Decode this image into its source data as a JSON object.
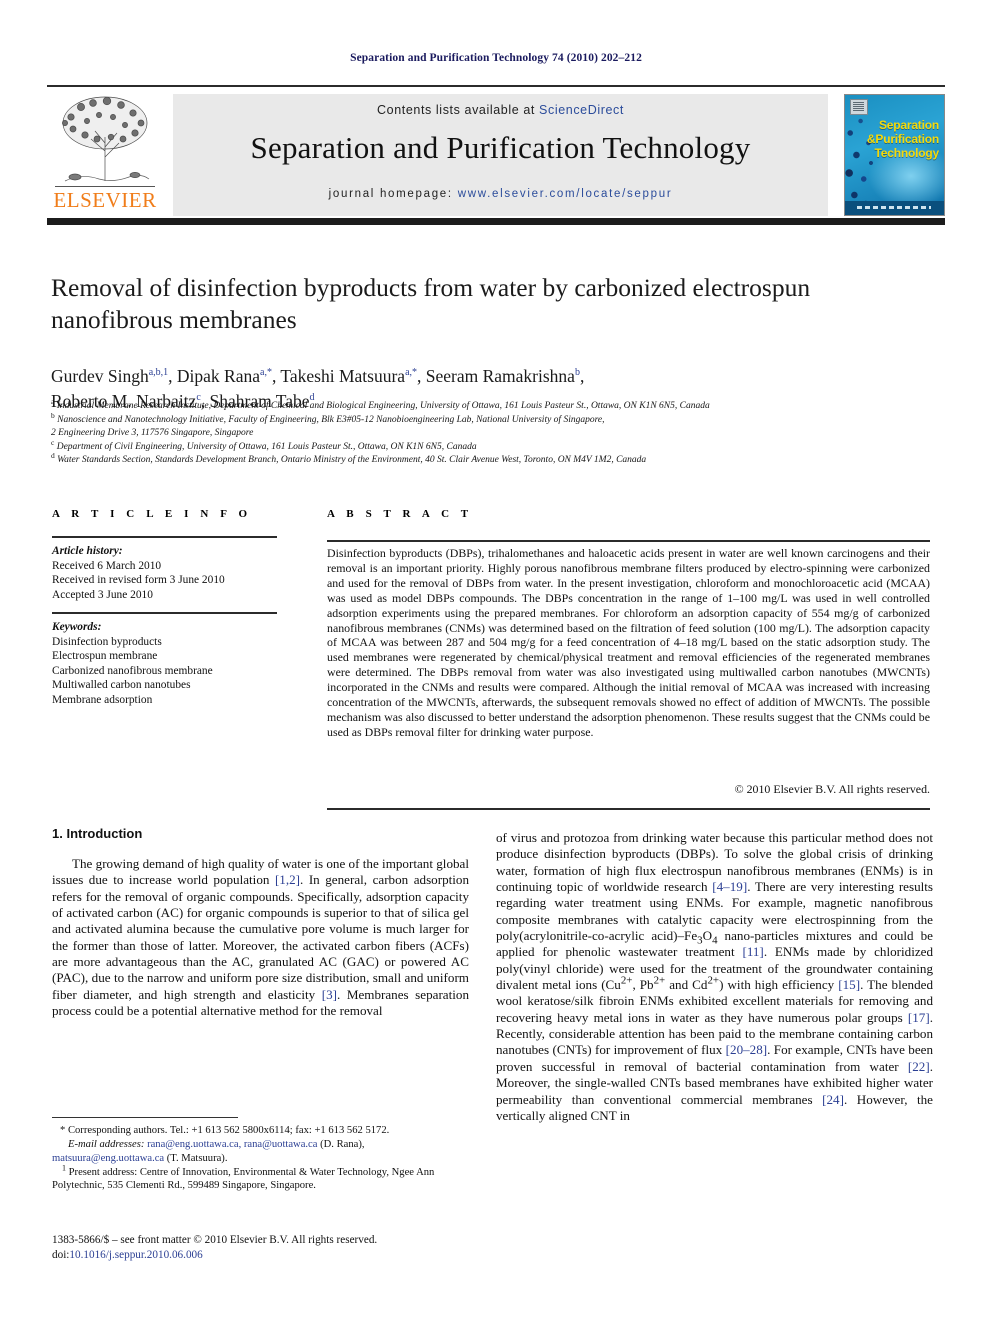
{
  "running_head": "Separation and Purification Technology 74 (2010) 202–212",
  "masthead": {
    "contents_prefix": "Contents lists available at ",
    "contents_link": "ScienceDirect",
    "journal_title": "Separation and Purification Technology",
    "homepage_prefix": "journal homepage:",
    "homepage_url": "www.elsevier.com/locate/seppur",
    "publisher": "ELSEVIER",
    "cover": {
      "line1": "Separation",
      "line2": "&Purification",
      "line3": "Technology"
    }
  },
  "article": {
    "title": "Removal of disinfection byproducts from water by carbonized electrospun nanofibrous membranes",
    "authors_line1": "Gurdev Singh<sup>a,b,1</sup>, Dipak Rana<sup>a,*</sup>, Takeshi Matsuura<sup>a,*</sup>, Seeram Ramakrishna<sup>b</sup>,",
    "authors_line2": "Roberto M. Narbaitz<sup>c</sup>, Shahram Tabe<sup>d</sup>",
    "affiliations": [
      "<sup>a</sup> Industrial Membrane Research Institute, Department of Chemical and Biological Engineering, University of Ottawa, 161 Louis Pasteur St., Ottawa, ON K1N 6N5, Canada",
      "<sup>b</sup> Nanoscience and Nanotechnology Initiative, Faculty of Engineering, Blk E3#05-12 Nanobioengineering Lab, National University of Singapore,",
      "2 Engineering Drive 3, 117576 Singapore, Singapore",
      "<sup>c</sup> Department of Civil Engineering, University of Ottawa, 161 Louis Pasteur St., Ottawa, ON K1N 6N5, Canada",
      "<sup>d</sup> Water Standards Section, Standards Development Branch, Ontario Ministry of the Environment, 40 St. Clair Avenue West, Toronto, ON M4V 1M2, Canada"
    ]
  },
  "info": {
    "heading": "A R T I C L E   I N F O",
    "history_label": "Article history:",
    "history": [
      "Received 6 March 2010",
      "Received in revised form 3 June 2010",
      "Accepted 3 June 2010"
    ],
    "keywords_label": "Keywords:",
    "keywords": [
      "Disinfection byproducts",
      "Electrospun membrane",
      "Carbonized nanofibrous membrane",
      "Multiwalled carbon nanotubes",
      "Membrane adsorption"
    ]
  },
  "abstract": {
    "heading": "A B S T R A C T",
    "text": "Disinfection byproducts (DBPs), trihalomethanes and haloacetic acids present in water are well known carcinogens and their removal is an important priority. Highly porous nanofibrous membrane filters produced by electro-spinning were carbonized and used for the removal of DBPs from water. In the present investigation, chloroform and monochloroacetic acid (MCAA) was used as model DBPs compounds. The DBPs concentration in the range of 1–100 mg/L was used in well controlled adsorption experiments using the prepared membranes. For chloroform an adsorption capacity of 554 mg/g of carbonized nanofibrous membranes (CNMs) was determined based on the filtration of feed solution (100 mg/L). The adsorption capacity of MCAA was between 287 and 504 mg/g for a feed concentration of 4–18 mg/L based on the static adsorption study. The used membranes were regenerated by chemical/physical treatment and removal efficiencies of the regenerated membranes were determined. The DBPs removal from water was also investigated using multiwalled carbon nanotubes (MWCNTs) incorporated in the CNMs and results were compared. Although the initial removal of MCAA was increased with increasing concentration of the MWCNTs, afterwards, the subsequent removals showed no effect of addition of MWCNTs. The possible mechanism was also discussed to better understand the adsorption phenomenon. These results suggest that the CNMs could be used as DBPs removal filter for drinking water purpose.",
    "copyright": "© 2010 Elsevier B.V. All rights reserved."
  },
  "body": {
    "section_title": "1. Introduction",
    "left_paragraph": "The growing demand of high quality of water is one of the important global issues due to increase world population <span class=\"ref\">[1,2]</span>. In general, carbon adsorption refers for the removal of organic compounds. Specifically, adsorption capacity of activated carbon (AC) for organic compounds is superior to that of silica gel and activated alumina because the cumulative pore volume is much larger for the former than those of latter. Moreover, the activated carbon fibers (ACFs) are more advantageous than the AC, granulated AC (GAC) or powered AC (PAC), due to the narrow and uniform pore size distribution, small and uniform fiber diameter, and high strength and elasticity <span class=\"ref\">[3]</span>. Membranes separation process could be a potential alternative method for the removal",
    "right_paragraph": "of virus and protozoa from drinking water because this particular method does not produce disinfection byproducts (DBPs). To solve the global crisis of drinking water, formation of high flux electrospun nanofibrous membranes (ENMs) is in continuing topic of worldwide research <span class=\"ref\">[4–19]</span>. There are very interesting results regarding water treatment using ENMs. For example, magnetic nanofibrous composite membranes with catalytic capacity were electrospinning from the poly(acrylonitrile-co-acrylic acid)–Fe<sub>3</sub>O<sub>4</sub> nano-particles mixtures and could be applied for phenolic wastewater treatment <span class=\"ref\">[11]</span>. ENMs made by chloridized poly(vinyl chloride) were used for the treatment of the groundwater containing divalent metal ions (Cu<sup>2+</sup>, Pb<sup>2+</sup> and Cd<sup>2+</sup>) with high efficiency <span class=\"ref\">[15]</span>. The blended wool keratose/silk fibroin ENMs exhibited excellent materials for removing and recovering heavy metal ions in water as they have numerous polar groups <span class=\"ref\">[17]</span>. Recently, considerable attention has been paid to the membrane containing carbon nanotubes (CNTs) for improvement of flux <span class=\"ref\">[20–28]</span>. For example, CNTs have been proven successful in removal of bacterial contamination from water <span class=\"ref\">[22]</span>. Moreover, the single-walled CNTs based membranes have exhibited higher water permeability than conventional commercial membranes <span class=\"ref\">[24]</span>. However, the vertically aligned CNT in"
  },
  "footnotes": {
    "corresponding": "* Corresponding authors. Tel.: +1 613 562 5800x6114; fax: +1 613 562 5172.",
    "email_label": "E-mail addresses:",
    "email_line1_links": "rana@eng.uottawa.ca, rana@uottawa.ca",
    "email_line1_suffix": " (D. Rana),",
    "email_line2_link": "matsuura@eng.uottawa.ca",
    "email_line2_suffix": " (T. Matsuura).",
    "present_address": "Present address: Centre of Innovation, Environmental & Water Technology, Ngee Ann Polytechnic, 535 Clementi Rd., 599489 Singapore, Singapore.",
    "present_address_marker": "1"
  },
  "imprint": {
    "issn_line": "1383-5866/$ – see front matter © 2010 Elsevier B.V. All rights reserved.",
    "doi_label": "doi:",
    "doi_value": "10.1016/j.seppur.2010.06.006"
  },
  "colors": {
    "running_head": "#1a1a5e",
    "link": "#2b3f93",
    "elsevier_orange": "#f07d1a",
    "band_grey": "#e9e9e9"
  }
}
